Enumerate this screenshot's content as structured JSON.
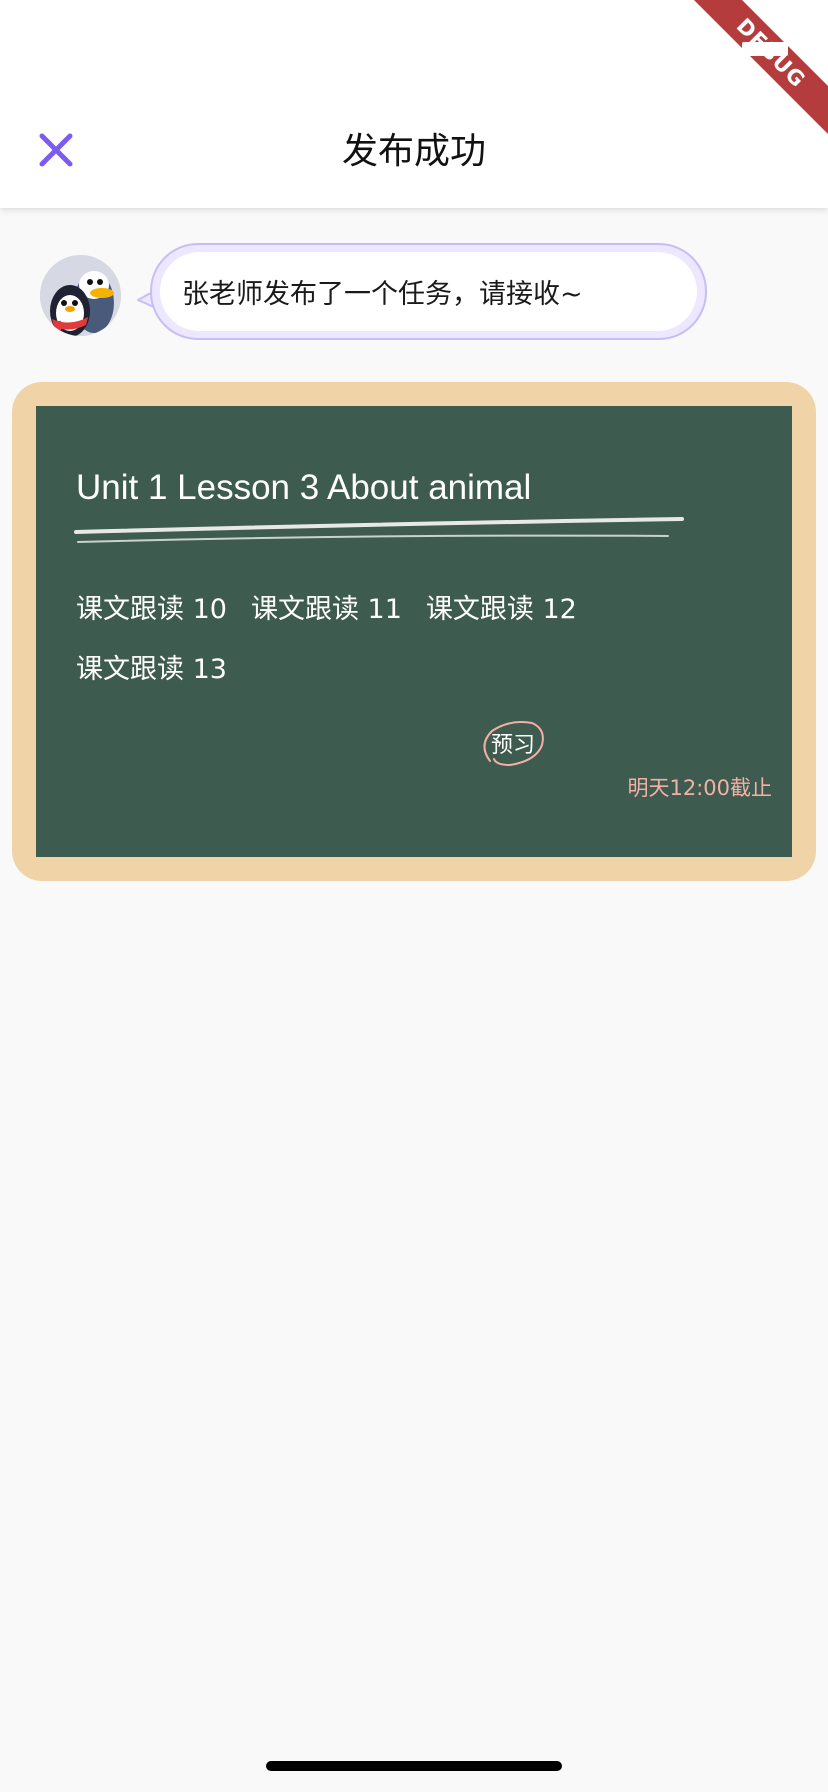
{
  "header": {
    "title": "发布成功",
    "close_icon": "close-icon",
    "accent_color": "#7c5cf0"
  },
  "debug_banner": {
    "label": "DEBUG"
  },
  "message": {
    "avatar_icon": "penguin-avatar",
    "text": "张老师发布了一个任务，请接收~"
  },
  "task_card": {
    "title": "Unit 1 Lesson 3 About animal",
    "items": [
      "课文跟读 10",
      "课文跟读 11",
      "课文跟读 12",
      "课文跟读 13"
    ],
    "badge": "预习",
    "deadline": "明天12:00截止",
    "board_color": "#3e5b4f",
    "frame_color": "#f0d4a8"
  }
}
